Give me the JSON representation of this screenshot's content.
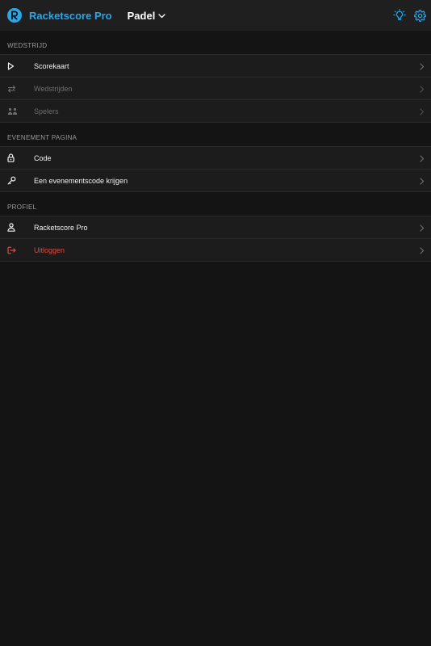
{
  "header": {
    "app_name": "Racketscore Pro",
    "sport_selector": "Padel",
    "accent_color": "#2aa6e8"
  },
  "sections": [
    {
      "title": "WEDSTRIJD",
      "items": [
        {
          "label": "Scorekaart",
          "icon": "play-icon",
          "state": "enabled"
        },
        {
          "label": "Wedstrijden",
          "icon": "swap-arrows-icon",
          "state": "disabled"
        },
        {
          "label": "Spelers",
          "icon": "players-icon",
          "state": "disabled"
        }
      ]
    },
    {
      "title": "EVENEMENT PAGINA",
      "items": [
        {
          "label": "Code",
          "icon": "lock-icon",
          "state": "enabled"
        },
        {
          "label": "Een evenementscode krijgen",
          "icon": "key-icon",
          "state": "enabled"
        }
      ]
    },
    {
      "title": "PROFIEL",
      "items": [
        {
          "label": "Racketscore Pro",
          "icon": "person-icon",
          "state": "enabled"
        },
        {
          "label": "Uitloggen",
          "icon": "logout-icon",
          "state": "danger",
          "color": "#e5483c"
        }
      ]
    }
  ]
}
